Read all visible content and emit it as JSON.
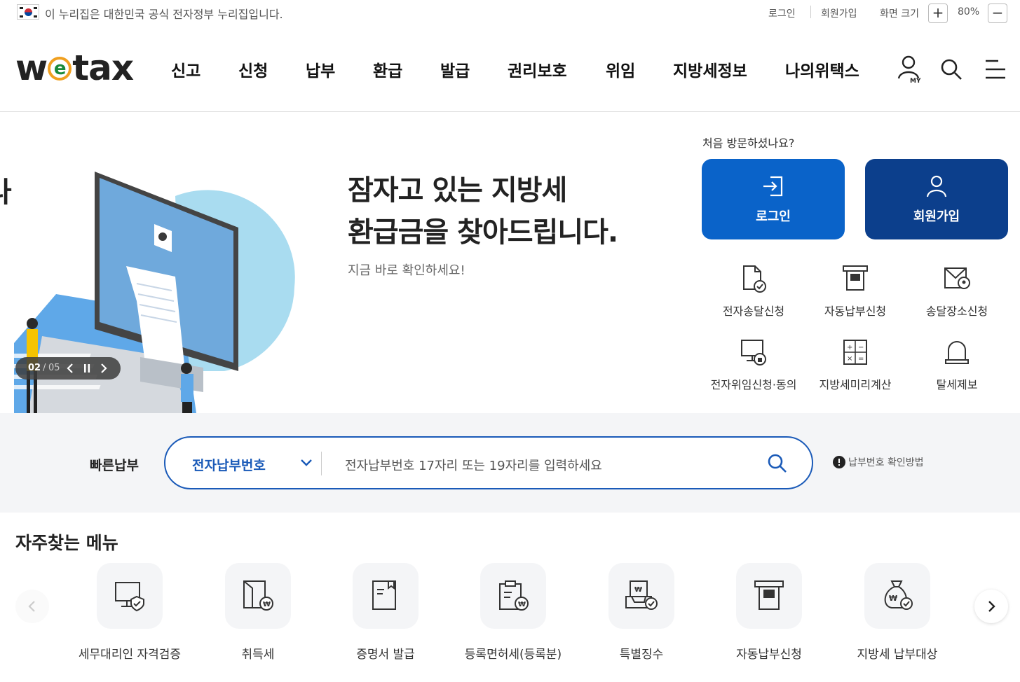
{
  "gov_banner": {
    "text": "이 누리집은 대한민국 공식 전자정부 누리집입니다."
  },
  "util": {
    "login": "로그인",
    "signup": "회원가입",
    "zoom_label": "화면 크기",
    "zoom_in": "+",
    "zoom_value": "80%",
    "zoom_out": "−"
  },
  "logo": {
    "w": "w",
    "e": "e",
    "tax": "tax"
  },
  "nav": [
    "신고",
    "신청",
    "납부",
    "환급",
    "발급",
    "권리보호",
    "위임",
    "지방세정보",
    "나의위택스"
  ],
  "header_icons": {
    "my_badge": "MY"
  },
  "hero": {
    "title_line1": "잠자고 있는 지방세",
    "title_line2": "환급금을 찾아드립니다.",
    "subtitle": "지금 바로 확인하세요!",
    "slide_current": "02",
    "slide_sep": "/",
    "slide_total": "05",
    "left_fragment": "나"
  },
  "panel": {
    "visit_prompt": "처음 방문하셨나요?",
    "login_button": "로그인",
    "signup_button": "회원가입",
    "quick": [
      "전자송달신청",
      "자동납부신청",
      "송달장소신청",
      "전자위임신청·동의",
      "지방세미리계산",
      "탈세제보"
    ]
  },
  "quickpay": {
    "label": "빠른납부",
    "select": "전자납부번호",
    "placeholder": "전자납부번호 17자리 또는 19자리를 입력하세요",
    "help": "납부번호 확인방법"
  },
  "frequent": {
    "title": "자주찾는 메뉴",
    "items": [
      "세무대리인 자격검증",
      "취득세",
      "증명서 발급",
      "등록면허세(등록분)",
      "특별징수",
      "자동납부신청",
      "지방세 납부대상"
    ]
  },
  "colors": {
    "primary": "#0a63c9",
    "dark_blue": "#0c3f8c",
    "accent_blue": "#1a5ab8"
  }
}
